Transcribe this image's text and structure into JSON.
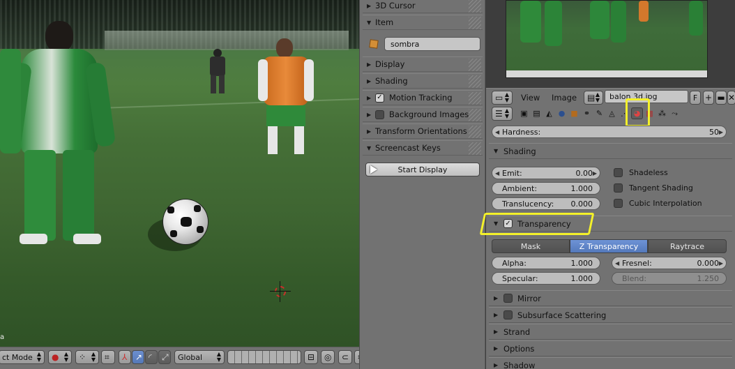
{
  "npanel": {
    "items": [
      {
        "label": "3D Cursor",
        "expanded": false
      },
      {
        "label": "Item",
        "expanded": true
      },
      {
        "label": "Display",
        "expanded": false
      },
      {
        "label": "Shading",
        "expanded": false
      },
      {
        "label": "Motion Tracking",
        "expanded": false,
        "checkbox": true
      },
      {
        "label": "Background Images",
        "expanded": false,
        "checkbox": false
      },
      {
        "label": "Transform Orientations",
        "expanded": false
      },
      {
        "label": "Screencast Keys",
        "expanded": true
      }
    ],
    "object_name": "sombra",
    "start_display": "Start Display"
  },
  "viewport_header": {
    "mode": "ct Mode",
    "orientation": "Global"
  },
  "viewport": {
    "corner_text": "a"
  },
  "image_editor": {
    "menu_view": "View",
    "menu_image": "Image",
    "image_name": "balon 3d.jpg",
    "fake_user": "F"
  },
  "material": {
    "hardness": {
      "label": "Hardness:",
      "value": "50"
    },
    "shading": {
      "title": "Shading",
      "emit": {
        "label": "Emit:",
        "value": "0.00"
      },
      "ambient": {
        "label": "Ambient:",
        "value": "1.000"
      },
      "translucency": {
        "label": "Translucency:",
        "value": "0.000"
      },
      "shadeless": {
        "label": "Shadeless",
        "checked": false
      },
      "tangent": {
        "label": "Tangent Shading",
        "checked": false
      },
      "cubic": {
        "label": "Cubic Interpolation",
        "checked": false
      }
    },
    "transparency": {
      "title": "Transparency",
      "enabled": true,
      "modes": [
        "Mask",
        "Z Transparency",
        "Raytrace"
      ],
      "active_mode": "Z Transparency",
      "alpha": {
        "label": "Alpha:",
        "value": "1.000"
      },
      "specular": {
        "label": "Specular:",
        "value": "1.000"
      },
      "fresnel": {
        "label": "Fresnel:",
        "value": "0.000"
      },
      "blend": {
        "label": "Blend:",
        "value": "1.250"
      }
    },
    "panels": [
      {
        "label": "Mirror",
        "checkbox": false
      },
      {
        "label": "Subsurface Scattering",
        "checkbox": false
      },
      {
        "label": "Strand"
      },
      {
        "label": "Options"
      },
      {
        "label": "Shadow"
      }
    ]
  },
  "colors": {
    "highlight": "#f4f12a",
    "active_blue": "#5479bb",
    "panel_gray": "#727272"
  }
}
